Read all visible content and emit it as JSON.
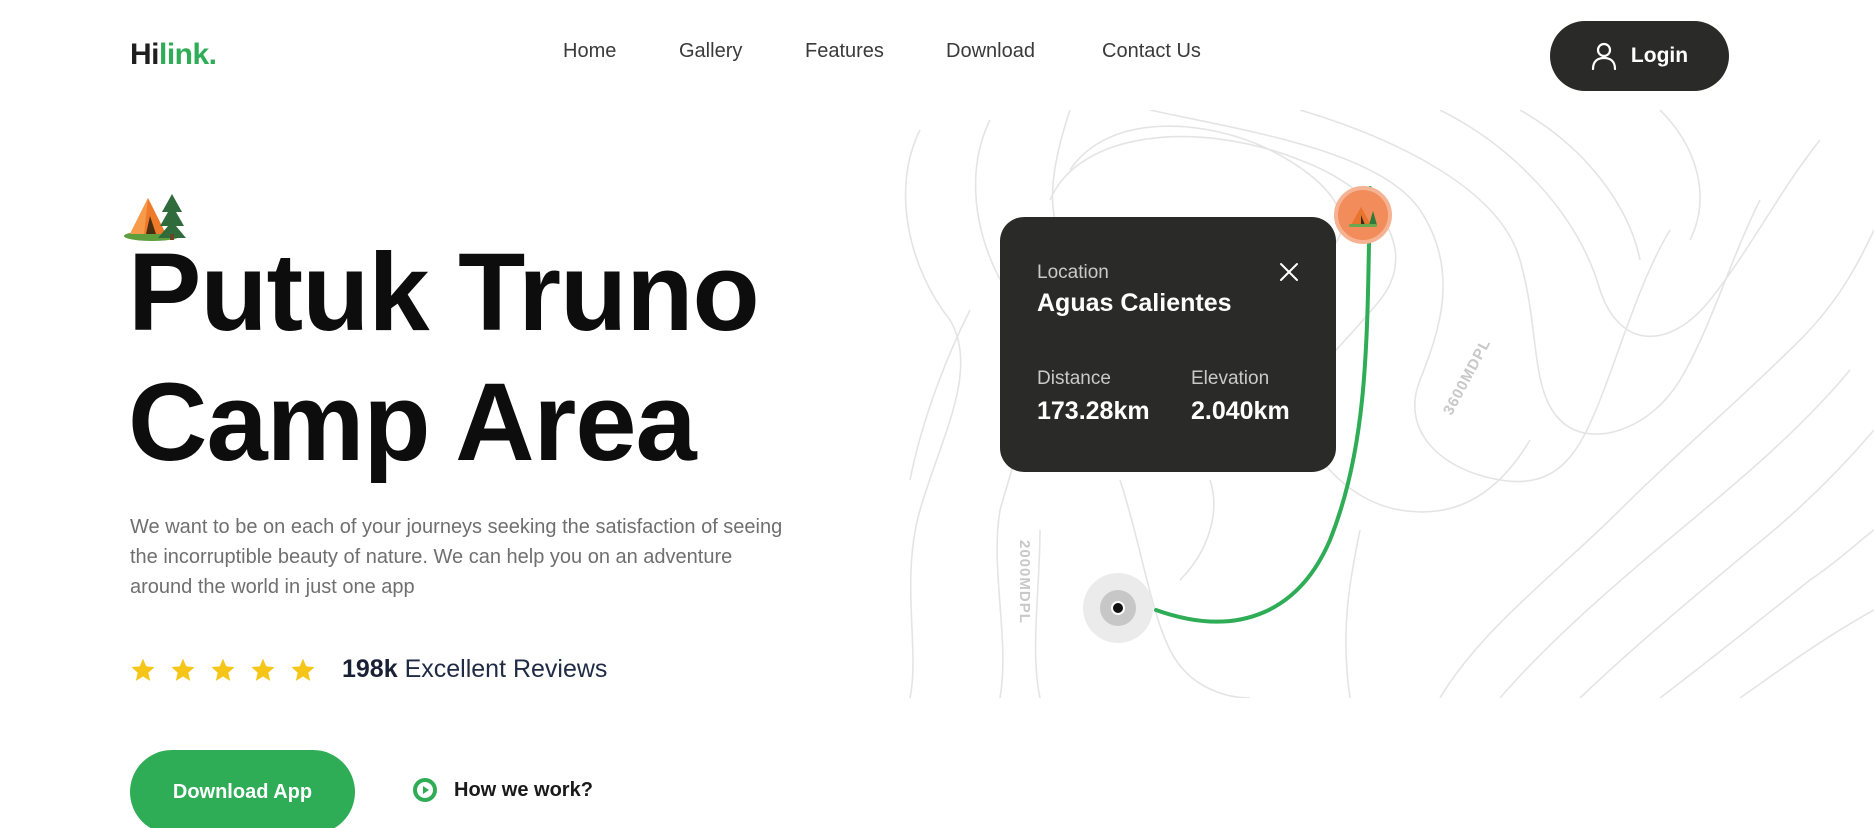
{
  "header": {
    "logo_hi": "Hi",
    "logo_link": "link.",
    "nav": [
      {
        "label": "Home"
      },
      {
        "label": "Gallery"
      },
      {
        "label": "Features"
      },
      {
        "label": "Download"
      },
      {
        "label": "Contact Us"
      }
    ],
    "login_label": "Login"
  },
  "hero": {
    "title_line1": "Putuk Truno",
    "title_line2": "Camp Area",
    "description": "We want to be on each of your journeys seeking the satisfaction of seeing the incorruptible beauty of nature. We can help you on an adventure around the world in just one app",
    "rating": {
      "stars": 5,
      "count": "198k",
      "label": "Excellent Reviews"
    },
    "download_label": "Download App",
    "how_label": "How we work?"
  },
  "map": {
    "card": {
      "location_label": "Location",
      "location_value": "Aguas Calientes",
      "distance_label": "Distance",
      "distance_value": "173.28km",
      "elevation_label": "Elevation",
      "elevation_value": "2.040km"
    },
    "contour_label_1": "3600MDPL",
    "contour_label_2": "2000MDPL"
  },
  "icons": {
    "login": "user-icon",
    "close": "close-icon",
    "star": "star-icon",
    "play": "play-circle-icon",
    "tent": "tent-icon"
  },
  "colors": {
    "brand_green": "#2eac56",
    "dark": "#2a2b29",
    "star_yellow": "#f5c518",
    "pin_orange": "#f28c5a"
  }
}
